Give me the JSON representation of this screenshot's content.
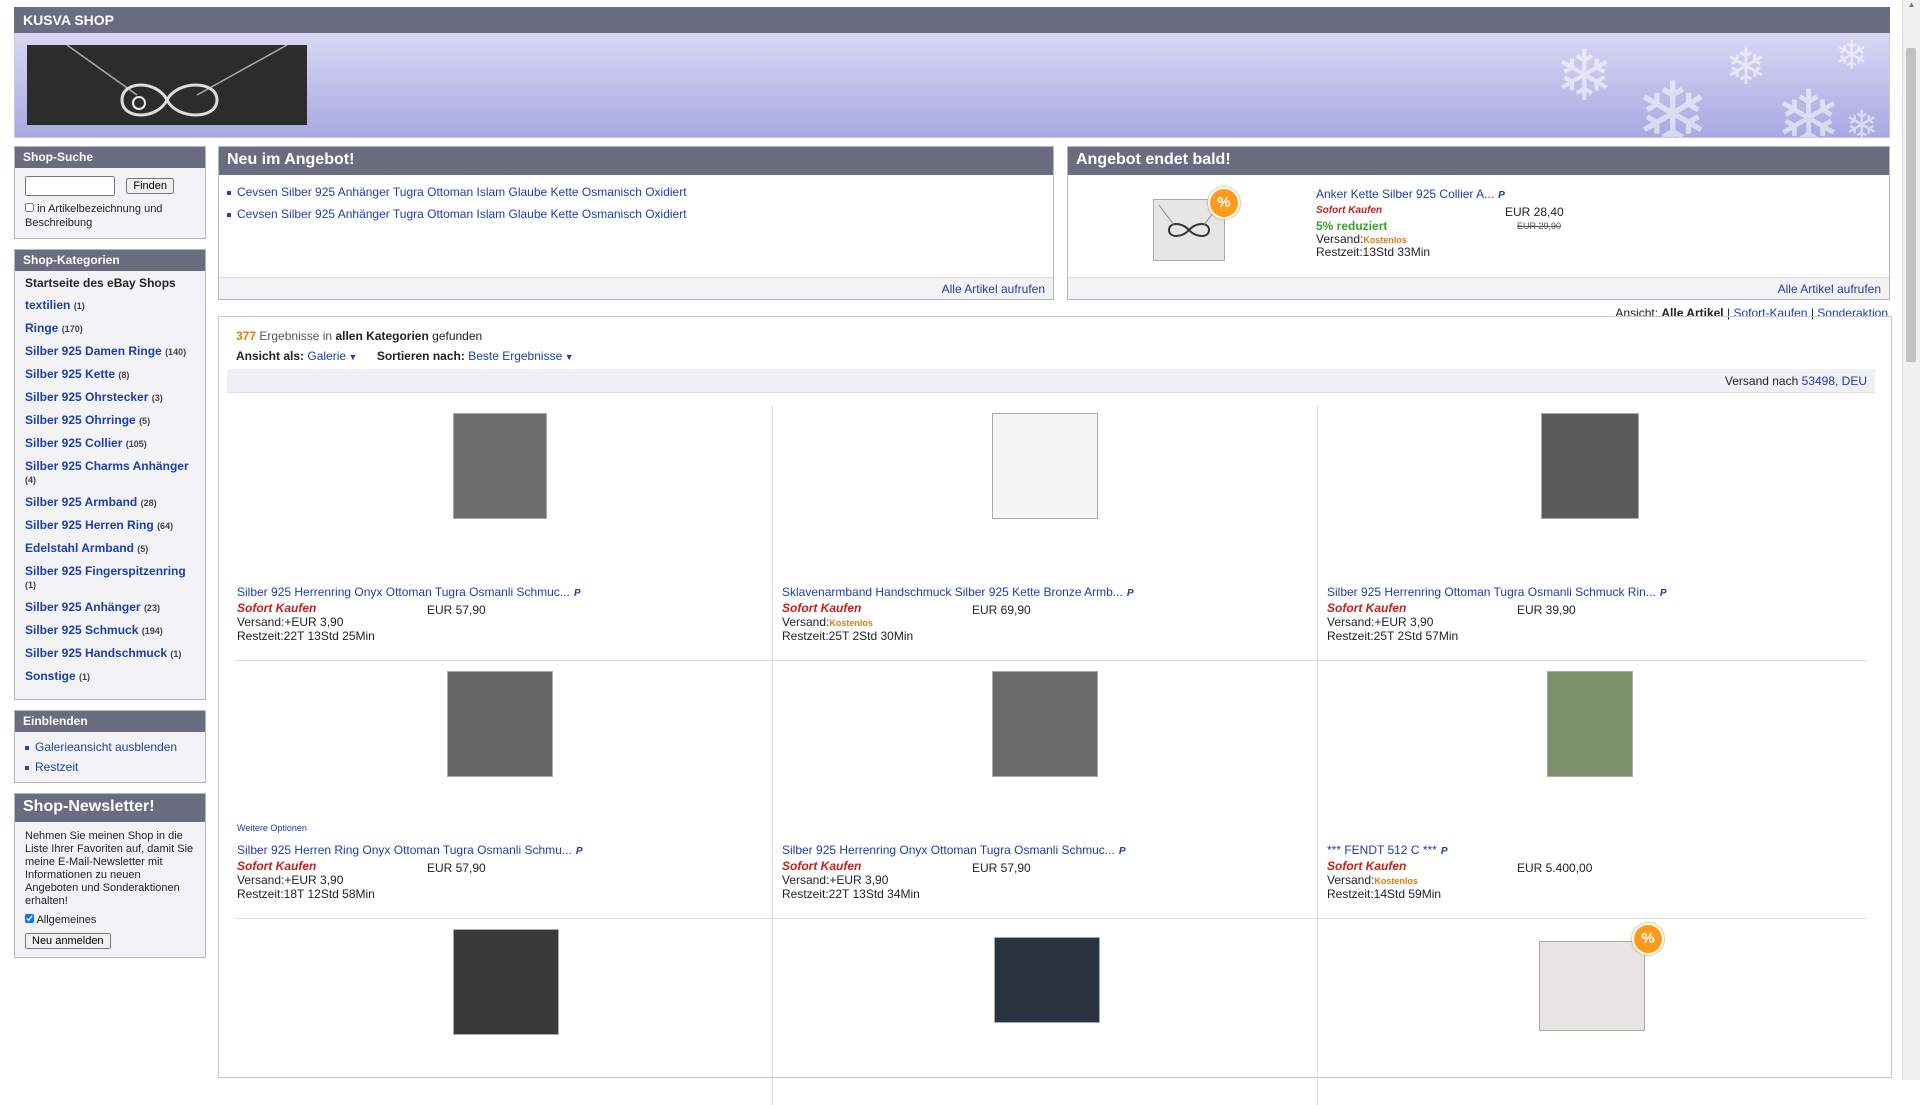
{
  "shop": {
    "title": "KUSVA SHOP"
  },
  "sidebar": {
    "search": {
      "header": "Shop-Suche",
      "button": "Finden",
      "checkbox_label": "in Artikelbezeichnung und Beschreibung",
      "placeholder": ""
    },
    "categories": {
      "header": "Shop-Kategorien",
      "home": "Startseite des eBay Shops",
      "items": [
        {
          "label": "textilien",
          "count": "(1)"
        },
        {
          "label": "Ringe",
          "count": "(170)"
        },
        {
          "label": "Silber 925 Damen Ringe",
          "count": "(140)"
        },
        {
          "label": "Silber 925 Kette",
          "count": "(8)"
        },
        {
          "label": "Silber 925 Ohrstecker",
          "count": "(3)"
        },
        {
          "label": "Silber 925 Ohrringe",
          "count": "(5)"
        },
        {
          "label": "Silber 925 Collier",
          "count": "(105)"
        },
        {
          "label": "Silber 925 Charms Anhänger",
          "count": "(4)"
        },
        {
          "label": "Silber 925 Armband",
          "count": "(28)"
        },
        {
          "label": "Silber 925 Herren Ring",
          "count": "(64)"
        },
        {
          "label": "Edelstahl Armband",
          "count": "(5)"
        },
        {
          "label": "Silber 925 Fingerspitzenring",
          "count": "(1)"
        },
        {
          "label": "Silber 925 Anhänger",
          "count": "(23)"
        },
        {
          "label": "Silber 925 Schmuck",
          "count": "(194)"
        },
        {
          "label": "Silber 925 Handschmuck",
          "count": "(1)"
        },
        {
          "label": "Sonstige",
          "count": "(1)"
        }
      ]
    },
    "einblenden": {
      "header": "Einblenden",
      "items": [
        "Galerieansicht ausblenden",
        "Restzeit"
      ]
    },
    "newsletter": {
      "header": "Shop-Newsletter!",
      "text": "Nehmen Sie meinen Shop in die Liste Ihrer Favoriten auf, damit Sie meine E-Mail-Newsletter mit Informationen zu neuen Angeboten und Sonderaktionen erhalten!",
      "checkbox_label": "Allgemeines",
      "button": "Neu anmelden"
    }
  },
  "neu": {
    "header": "Neu im Angebot!",
    "items": [
      "Cevsen Silber 925 Anhänger Tugra Ottoman Islam Glaube Kette Osmanisch Oxidiert",
      "Cevsen Silber 925 Anhänger Tugra Ottoman Islam Glaube Kette Osmanisch Oxidiert"
    ],
    "footer": "Alle Artikel aufrufen"
  },
  "endet": {
    "header": "Angebot endet bald!",
    "title": "Anker Kette Silber 925 Collier A...",
    "sofort": "Sofort Kaufen",
    "price": "EUR 28,40",
    "old_price": "EUR 29,90",
    "discount": "5% reduziert",
    "versand_label": "Versand:",
    "versand_value": "Kostenlos",
    "restzeit": "Restzeit:13Std 33Min",
    "footer": "Alle Artikel aufrufen"
  },
  "view": {
    "label": "Ansicht:",
    "all": "Alle Artikel",
    "sofort": "Sofort-Kaufen",
    "sonder": "Sonderaktion"
  },
  "results": {
    "count": "377",
    "text1": "Ergebnisse in",
    "text2": "allen Kategorien",
    "text3": "gefunden",
    "ansicht_label": "Ansicht als:",
    "ansicht_value": "Galerie",
    "sort_label": "Sortieren nach:",
    "sort_value": "Beste Ergebnisse",
    "versand_label": "Versand nach",
    "versand_value": "53498, DEU"
  },
  "items": [
    {
      "title": "Silber 925 Herrenring Onyx Ottoman Tugra Osmanli Schmuc...",
      "price": "EUR 57,90",
      "versand": "Versand:+EUR 3,90",
      "versand_free": "",
      "restzeit": "Restzeit:22T 13Std 25Min",
      "extra": ""
    },
    {
      "title": "Sklavenarmband Handschmuck Silber 925 Kette Bronze Armb...",
      "price": "EUR 69,90",
      "versand": "Versand:",
      "versand_free": "Kostenlos",
      "restzeit": "Restzeit:25T 2Std 30Min",
      "extra": ""
    },
    {
      "title": "Silber 925 Herrenring Ottoman Tugra Osmanli Schmuck Rin...",
      "price": "EUR 39,90",
      "versand": "Versand:+EUR 3,90",
      "versand_free": "",
      "restzeit": "Restzeit:25T 2Std 57Min",
      "extra": ""
    },
    {
      "title": "Silber 925 Herren Ring Onyx Ottoman Tugra Osmanli Schmu...",
      "price": "EUR 57,90",
      "versand": "Versand:+EUR 3,90",
      "versand_free": "",
      "restzeit": "Restzeit:18T 12Std 58Min",
      "extra": "Weitere Optionen"
    },
    {
      "title": "Silber 925 Herrenring Onyx Ottoman Tugra Osmanli Schmuc...",
      "price": "EUR 57,90",
      "versand": "Versand:+EUR 3,90",
      "versand_free": "",
      "restzeit": "Restzeit:22T 13Std 34Min",
      "extra": ""
    },
    {
      "title": "*** FENDT 512 C ***",
      "price": "EUR 5.400,00",
      "versand": "Versand:",
      "versand_free": "Kostenlos",
      "restzeit": "Restzeit:14Std 59Min",
      "extra": ""
    }
  ],
  "sofort_label": "Sofort Kaufen",
  "paypal_label": "P",
  "discount_badge": "%"
}
